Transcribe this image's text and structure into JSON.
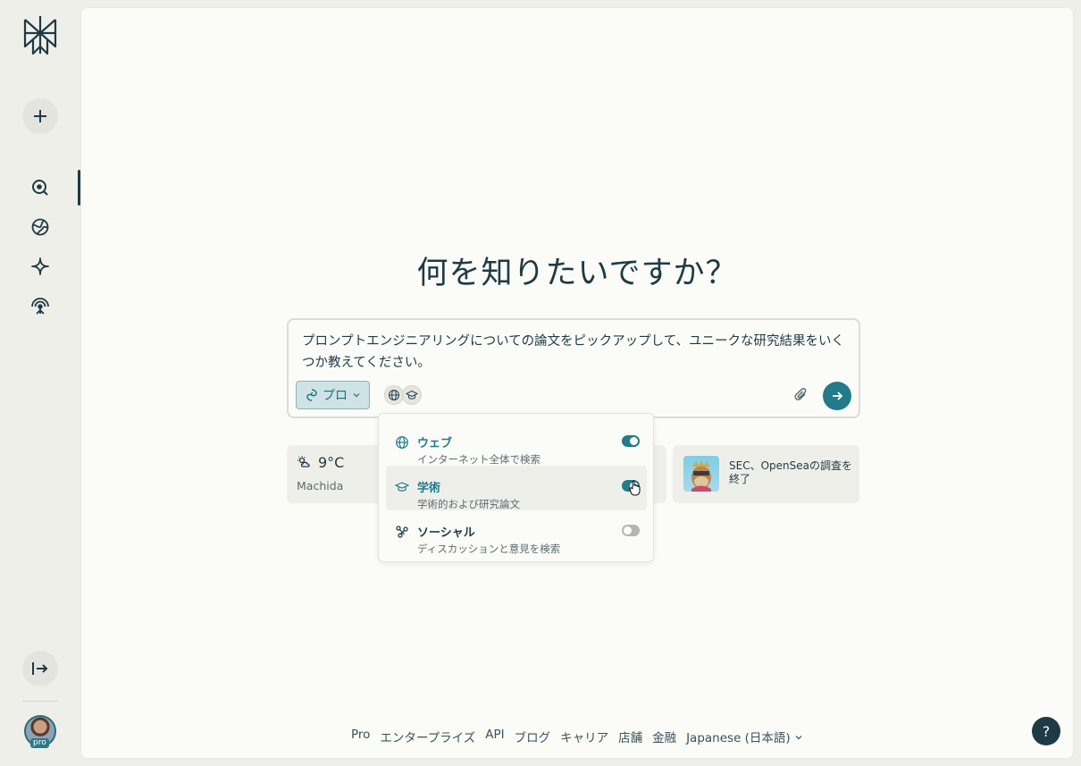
{
  "main": {
    "headline": "何を知りたいですか？"
  },
  "search": {
    "query": "プロンプトエンジニアリングについての論文をピックアップして、ユニークな研究結果をいくつか教えてください。",
    "mode_label": "プロ"
  },
  "sources_menu": {
    "items": [
      {
        "title": "ウェブ",
        "description": "インターネット全体で検索",
        "enabled": true,
        "icon": "globe-icon"
      },
      {
        "title": "学術",
        "description": "学術的および研究論文",
        "enabled": true,
        "icon": "graduation-cap-icon"
      },
      {
        "title": "ソーシャル",
        "description": "ディスカッションと意見を検索",
        "enabled": false,
        "icon": "network-icon"
      }
    ]
  },
  "widgets": {
    "weather": {
      "temp": "9°C",
      "city": "Machida"
    },
    "news": {
      "title": "SEC、OpenSeaの調査を終了"
    }
  },
  "footer": {
    "links": [
      "Pro",
      "エンタープライズ",
      "API",
      "ブログ",
      "キャリア",
      "店舗",
      "金融"
    ],
    "language": "Japanese (日本語)"
  },
  "help": {
    "label": "?"
  },
  "avatar": {
    "badge": "pro"
  },
  "colors": {
    "accent": "#227a8a",
    "text": "#1f3a44",
    "panel": "#fbfbf8",
    "sidebar": "#efefea"
  }
}
